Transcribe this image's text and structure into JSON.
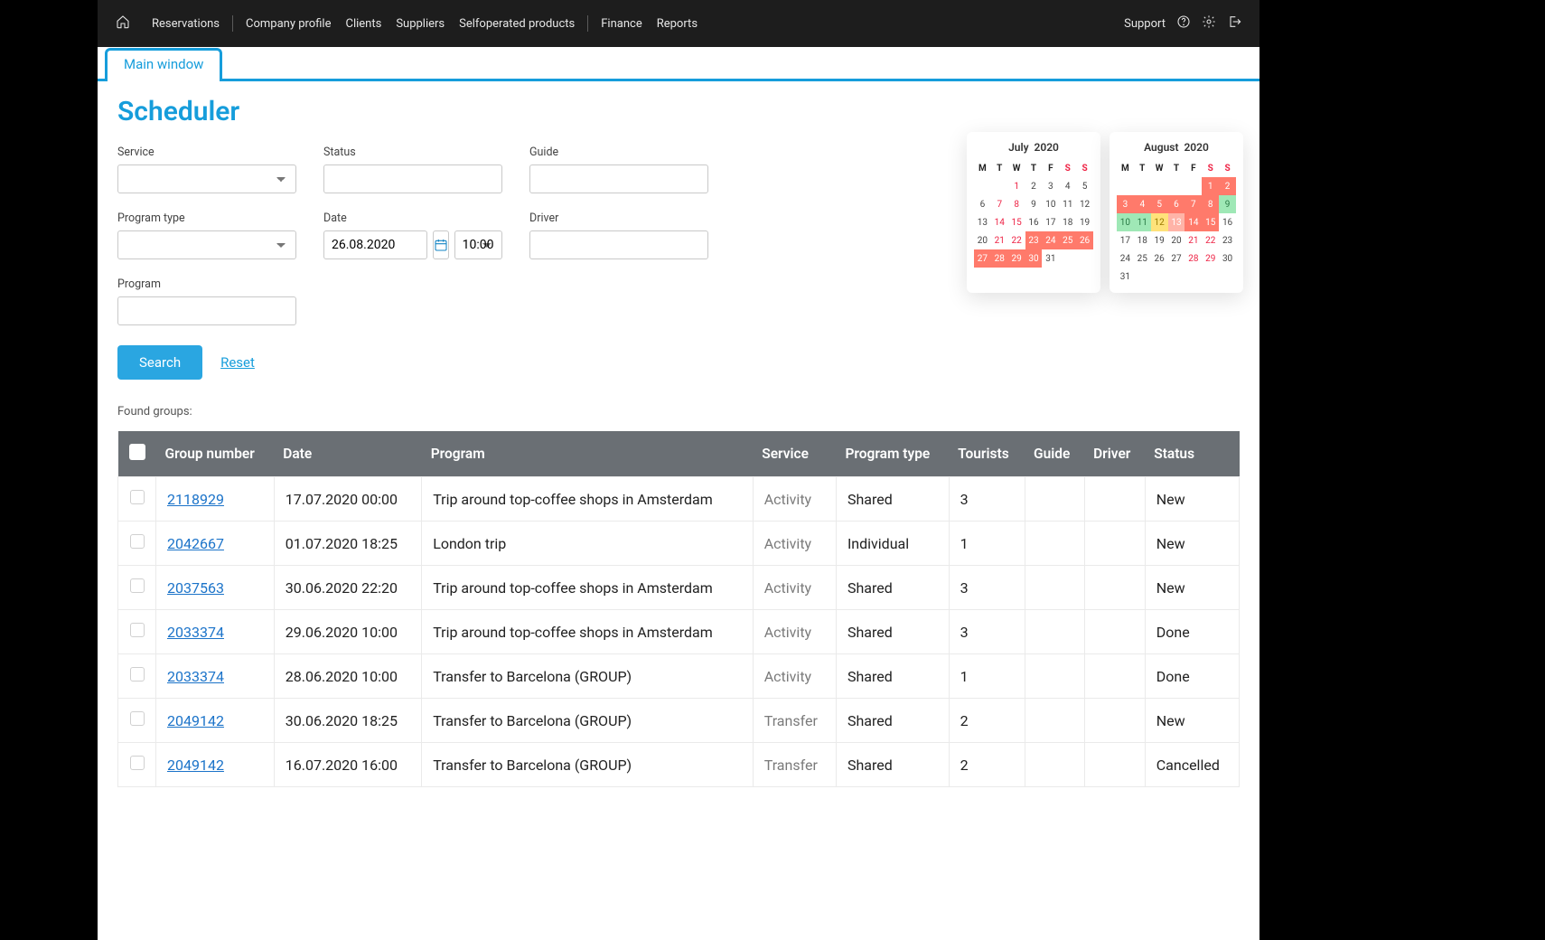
{
  "nav": {
    "items": [
      "Reservations",
      "Company profile",
      "Clients",
      "Suppliers",
      "Selfoperated products",
      "Finance",
      "Reports"
    ],
    "support": "Support"
  },
  "tabs": {
    "main": "Main window"
  },
  "page_title": "Scheduler",
  "filters": {
    "service_label": "Service",
    "status_label": "Status",
    "guide_label": "Guide",
    "program_type_label": "Program type",
    "date_label": "Date",
    "date_value": "26.08.2020",
    "time_value": "10:00",
    "driver_label": "Driver",
    "program_label": "Program",
    "search_btn": "Search",
    "reset_link": "Reset"
  },
  "found_label": "Found groups:",
  "table": {
    "headers": [
      "",
      "Group number",
      "Date",
      "Program",
      "Service",
      "Program type",
      "Tourists",
      "Guide",
      "Driver",
      "Status"
    ],
    "rows": [
      {
        "group": "2118929",
        "date": "17.07.2020 00:00",
        "program": "Trip around top-coffee shops in Amsterdam",
        "service": "Activity",
        "ptype": "Shared",
        "tourists": "3",
        "guide": "",
        "driver": "",
        "status": "New"
      },
      {
        "group": "2042667",
        "date": "01.07.2020 18:25",
        "program": "London trip",
        "service": "Activity",
        "ptype": "Individual",
        "tourists": "1",
        "guide": "",
        "driver": "",
        "status": "New"
      },
      {
        "group": "2037563",
        "date": "30.06.2020 22:20",
        "program": "Trip around top-coffee shops in Amsterdam",
        "service": "Activity",
        "ptype": "Shared",
        "tourists": "3",
        "guide": "",
        "driver": "",
        "status": "New"
      },
      {
        "group": "2033374",
        "date": "29.06.2020 10:00",
        "program": "Trip around top-coffee shops in Amsterdam",
        "service": "Activity",
        "ptype": "Shared",
        "tourists": "3",
        "guide": "",
        "driver": "",
        "status": "Done"
      },
      {
        "group": "2033374",
        "date": "28.06.2020 10:00",
        "program": "Transfer to Barcelona (GROUP)",
        "service": "Activity",
        "ptype": "Shared",
        "tourists": "1",
        "guide": "",
        "driver": "",
        "status": "Done"
      },
      {
        "group": "2049142",
        "date": "30.06.2020 18:25",
        "program": "Transfer to Barcelona (GROUP)",
        "service": "Transfer",
        "ptype": "Shared",
        "tourists": "2",
        "guide": "",
        "driver": "",
        "status": "New"
      },
      {
        "group": "2049142",
        "date": "16.07.2020 16:00",
        "program": "Transfer to Barcelona (GROUP)",
        "service": "Transfer",
        "ptype": "Shared",
        "tourists": "2",
        "guide": "",
        "driver": "",
        "status": "Cancelled"
      }
    ]
  },
  "dow": [
    "M",
    "T",
    "W",
    "T",
    "F",
    "S",
    "S"
  ],
  "calendars": [
    {
      "title": "July  2020",
      "lead_blanks": 2,
      "days": [
        {
          "n": 1,
          "hl": "weekend"
        },
        {
          "n": 2
        },
        {
          "n": 3
        },
        {
          "n": 4
        },
        {
          "n": 5
        },
        {
          "n": 6
        },
        {
          "n": 7,
          "hl": "weekend"
        },
        {
          "n": 8,
          "hl": "weekend"
        },
        {
          "n": 9
        },
        {
          "n": 10
        },
        {
          "n": 11
        },
        {
          "n": 12
        },
        {
          "n": 13
        },
        {
          "n": 14,
          "hl": "weekend"
        },
        {
          "n": 15,
          "hl": "weekend"
        },
        {
          "n": 16
        },
        {
          "n": 17
        },
        {
          "n": 18
        },
        {
          "n": 19
        },
        {
          "n": 20
        },
        {
          "n": 21,
          "hl": "weekend"
        },
        {
          "n": 22,
          "hl": "weekend"
        },
        {
          "n": 23,
          "hl": "red"
        },
        {
          "n": 24,
          "hl": "red"
        },
        {
          "n": 25,
          "hl": "red"
        },
        {
          "n": 26,
          "hl": "red"
        },
        {
          "n": 27,
          "hl": "red"
        },
        {
          "n": 28,
          "hl": "red"
        },
        {
          "n": 29,
          "hl": "red"
        },
        {
          "n": 30,
          "hl": "red"
        },
        {
          "n": 31
        }
      ]
    },
    {
      "title": "August  2020",
      "lead_blanks": 5,
      "days": [
        {
          "n": 1,
          "hl": "red"
        },
        {
          "n": 2,
          "hl": "red"
        },
        {
          "n": 3,
          "hl": "red"
        },
        {
          "n": 4,
          "hl": "red"
        },
        {
          "n": 5,
          "hl": "red"
        },
        {
          "n": 6,
          "hl": "red"
        },
        {
          "n": 7,
          "hl": "red"
        },
        {
          "n": 8,
          "hl": "red"
        },
        {
          "n": 9,
          "hl": "green"
        },
        {
          "n": 10,
          "hl": "green"
        },
        {
          "n": 11,
          "hl": "green"
        },
        {
          "n": 12,
          "hl": "yellow"
        },
        {
          "n": 13,
          "hl": "redlight"
        },
        {
          "n": 14,
          "hl": "red"
        },
        {
          "n": 15,
          "hl": "red"
        },
        {
          "n": 16
        },
        {
          "n": 17
        },
        {
          "n": 18
        },
        {
          "n": 19
        },
        {
          "n": 20
        },
        {
          "n": 21,
          "hl": "weekend"
        },
        {
          "n": 22,
          "hl": "weekend"
        },
        {
          "n": 23
        },
        {
          "n": 24
        },
        {
          "n": 25
        },
        {
          "n": 26
        },
        {
          "n": 27
        },
        {
          "n": 28,
          "hl": "weekend"
        },
        {
          "n": 29,
          "hl": "weekend"
        },
        {
          "n": 30
        },
        {
          "n": 31
        }
      ]
    }
  ]
}
